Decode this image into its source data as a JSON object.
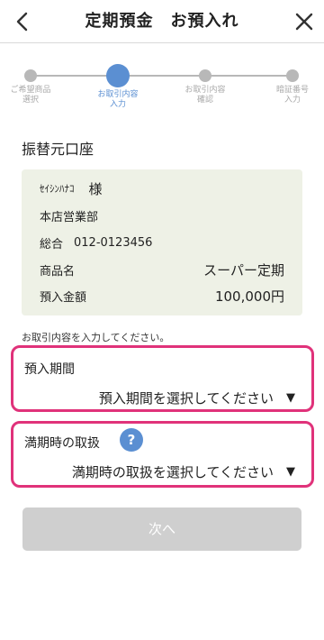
{
  "header": {
    "title": "定期預金　お預入れ",
    "back_icon": "chevron-left-icon",
    "close_icon": "close-icon"
  },
  "stepper": {
    "steps": [
      {
        "label": "ご希望商品\n選択",
        "active": false
      },
      {
        "label": "お取引内容\n入力",
        "active": true
      },
      {
        "label": "お取引内容\n確認",
        "active": false
      },
      {
        "label": "暗証番号\n入力",
        "active": false
      }
    ]
  },
  "account": {
    "section_title": "振替元口座",
    "holder_name": "ｾｲｼﾝﾊﾅｺ",
    "holder_suffix": "様",
    "branch": "本店営業部",
    "account_type": "総合",
    "account_number": "012-0123456",
    "product_label": "商品名",
    "product_value": "スーパー定期",
    "amount_label": "預入金額",
    "amount_value": "100,000円"
  },
  "instruction": "お取引内容を入力してください。",
  "period": {
    "label": "預入期間",
    "placeholder": "預入期間を選択してください"
  },
  "maturity": {
    "label": "満期時の取扱",
    "help": "?",
    "placeholder": "満期時の取扱を選択してください"
  },
  "arrow_glyph": "▼",
  "next_button": "次へ",
  "colors": {
    "accent": "#5b8fd2",
    "highlight_border": "#e0327a",
    "card_bg": "#eef1e6",
    "disabled_button": "#cfcfcf"
  }
}
